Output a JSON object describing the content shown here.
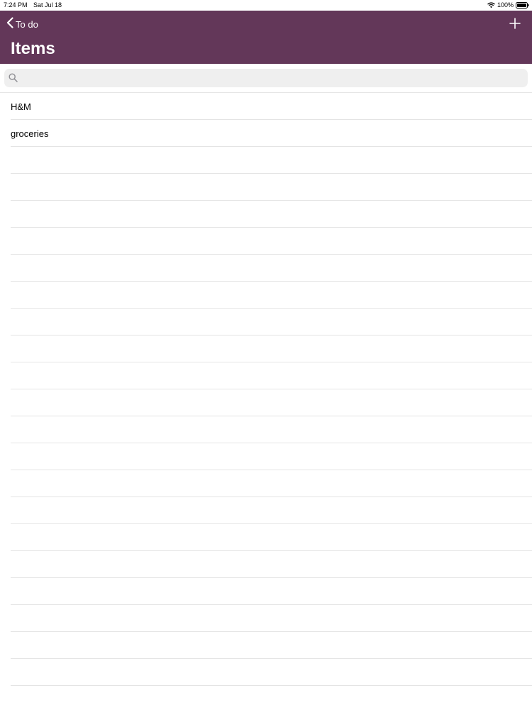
{
  "status_bar": {
    "time": "7:24 PM",
    "date": "Sat Jul 18",
    "battery": "100%"
  },
  "nav": {
    "back_label": "To do",
    "title": "Items",
    "add_icon": "plus-icon",
    "background_color": "#633759"
  },
  "search": {
    "placeholder": "",
    "value": ""
  },
  "items": [
    {
      "label": "H&M"
    },
    {
      "label": "groceries"
    }
  ]
}
